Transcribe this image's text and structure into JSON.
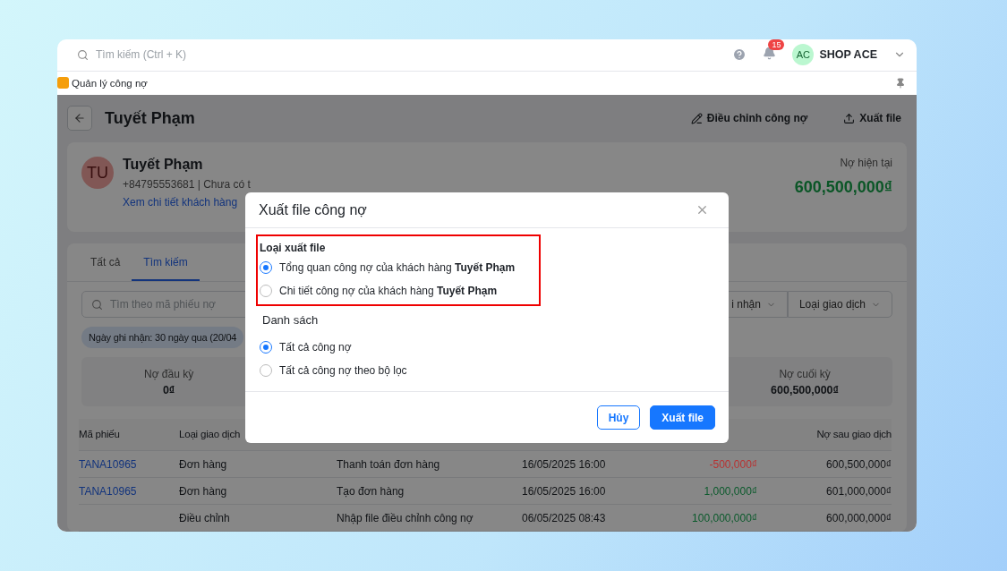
{
  "topbar": {
    "search_placeholder": "Tìm kiếm (Ctrl + K)",
    "notification_count": "15",
    "avatar": "AC",
    "shop": "SHOP ACE"
  },
  "tab_strip": {
    "label": "Quản lý công nợ"
  },
  "page": {
    "title": "Tuyết Phạm",
    "actions": [
      {
        "kind": "edit",
        "label": "Điều chỉnh công nợ"
      },
      {
        "kind": "export",
        "label": "Xuất file"
      }
    ]
  },
  "customer": {
    "initials": "TU",
    "name": "Tuyết Phạm",
    "contact": "+84795553681 | Chưa có t",
    "link": "Xem chi tiết khách hàng",
    "debt_label": "Nợ hiện tại",
    "debt_value": "600,500,000₫"
  },
  "tabs": [
    {
      "label": "Tất cả",
      "selected": false
    },
    {
      "label": "Tìm kiếm",
      "selected": true
    }
  ],
  "filter_bar": {
    "search_placeholder": "Tìm theo mã phiếu nợ",
    "filters": [
      "i nhận",
      "Loại giao dịch"
    ],
    "chip": "Ngày ghi nhận: 30 ngày qua (20/04"
  },
  "summary": [
    {
      "label": "Nợ đầu kỳ",
      "value": "0₫"
    },
    {
      "label": "Nợ cuối kỳ",
      "value": "600,500,000₫"
    }
  ],
  "table": {
    "columns": [
      "Mã phiếu",
      "Loại giao dịch",
      "Nợ sau giao dịch"
    ],
    "rows": [
      {
        "code": "TANA10965",
        "type": "Đơn hàng",
        "reason": "Thanh toán đơn hàng",
        "date": "16/05/2025 16:00",
        "change": "-500,000₫",
        "color": "#b83232",
        "balance": "600,500,000₫"
      },
      {
        "code": "TANA10965",
        "type": "Đơn hàng",
        "reason": "Tạo đơn hàng",
        "date": "16/05/2025 16:00",
        "change": "1,000,000₫",
        "color": "#0b5a2c",
        "balance": "601,000,000₫"
      },
      {
        "type": "Điều chỉnh",
        "reason": "Nhập file điều chỉnh công nợ",
        "date": "06/05/2025 08:43",
        "change": "100,000,000₫",
        "color": "#0b5a2c",
        "balance": "600,000,000₫"
      }
    ]
  },
  "modal": {
    "title": "Xuất file công nợ",
    "sections": [
      {
        "title": "Loại xuất file",
        "highlighted": true,
        "options": [
          {
            "label": "Tổng quan công nợ của khách hàng **Tuyết Phạm**",
            "selected": true
          },
          {
            "label": "Chi tiết công nợ của khách hàng **Tuyết Phạm**",
            "selected": false
          }
        ]
      },
      {
        "title": "Danh sách",
        "highlighted": false,
        "options": [
          {
            "label": "Tất cả công nợ",
            "selected": true
          },
          {
            "label": "Tất cả công nợ theo bộ lọc",
            "selected": false
          }
        ]
      }
    ],
    "buttons": [
      {
        "label": "Hủy",
        "kind": "secondary"
      },
      {
        "label": "Xuất file",
        "kind": "primary"
      }
    ]
  }
}
